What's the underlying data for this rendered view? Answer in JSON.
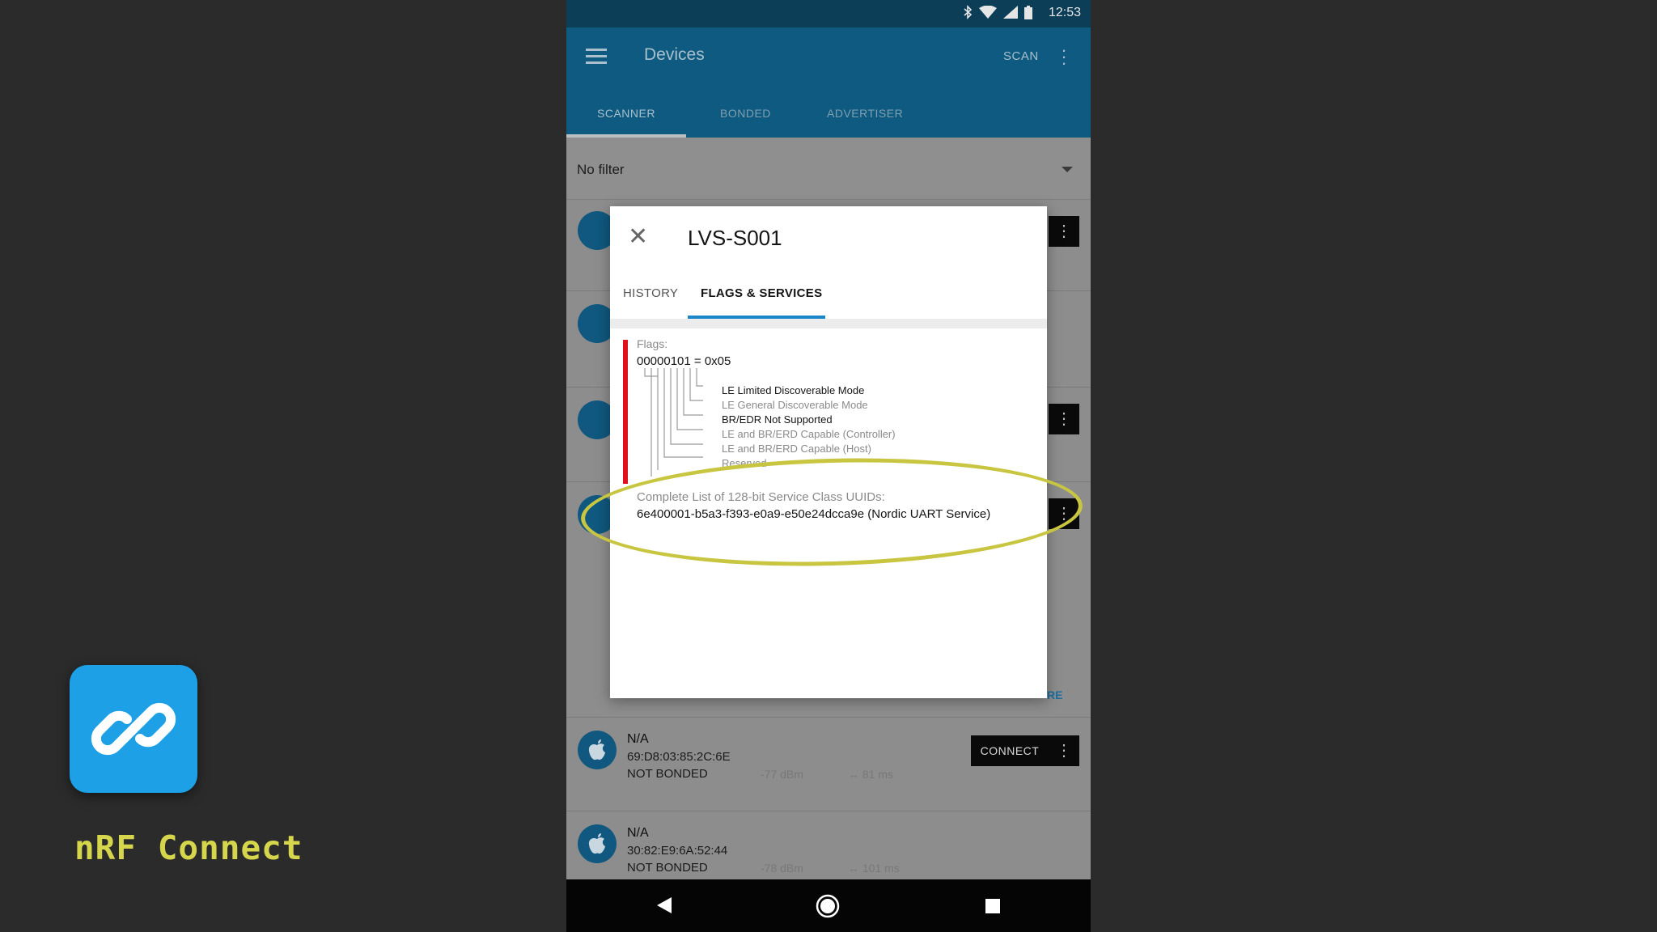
{
  "branding": {
    "app_name": "nRF Connect",
    "icon": "nrf-connect-link-icon",
    "icon_color": "#1ea0e6"
  },
  "status_bar": {
    "time": "12:53",
    "icons": [
      "bluetooth-icon",
      "wifi-icon",
      "signal-icon",
      "battery-icon"
    ]
  },
  "app_bar": {
    "title": "Devices",
    "scan_label": "SCAN",
    "tabs": [
      "SCANNER",
      "BONDED",
      "ADVERTISER"
    ],
    "active_tab": "SCANNER"
  },
  "filter": {
    "label": "No filter"
  },
  "devices": [
    {
      "name": "N/A",
      "address": "69:D8:03:85:2C:6E",
      "bond": "NOT BONDED",
      "rssi": "-77 dBm",
      "interval": "↔ 81 ms",
      "connect_label": "CONNECT"
    },
    {
      "name": "N/A",
      "address": "30:82:E9:6A:52:44",
      "bond": "NOT BONDED",
      "rssi": "-78 dBm",
      "interval": "↔ 101 ms"
    }
  ],
  "partial_text": {
    "more_label_fragment": "RE"
  },
  "dialog": {
    "title": "LVS-S001",
    "tabs": [
      "HISTORY",
      "FLAGS & SERVICES"
    ],
    "active_tab": "FLAGS & SERVICES",
    "flags_label": "Flags:",
    "flags_value": "00000101 = 0x05",
    "flag_bits": [
      "LE Limited Discoverable Mode",
      "LE General Discoverable Mode",
      "BR/EDR Not Supported",
      "LE and BR/ERD Capable (Controller)",
      "LE and BR/ERD Capable (Host)",
      "Reserved"
    ],
    "uuid_label": "Complete List of 128-bit Service Class UUIDs:",
    "uuid_value": "6e400001-b5a3-f393-e0a9-e50e24dcca9e (Nordic UART Service)"
  },
  "colors": {
    "appbar": "#0e5a80",
    "highlight": "#c8c640",
    "red_bar": "#e0101c",
    "active_tab_indicator": "#1a86c8"
  }
}
